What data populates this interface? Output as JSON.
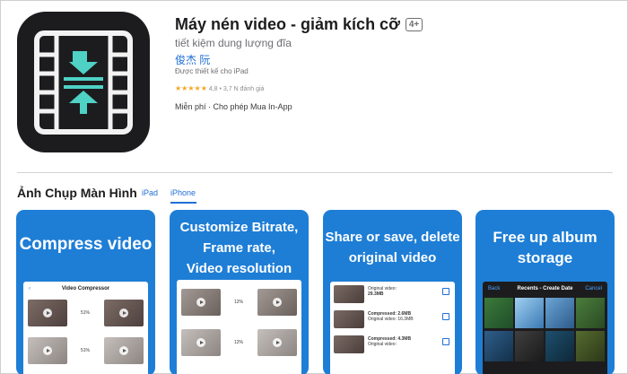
{
  "app": {
    "title": "Máy nén video - giảm kích cỡ",
    "age_rating": "4+",
    "subtitle": "tiết kiệm dung lượng đĩa",
    "developer": "俊杰 阮",
    "designed_for": "Được thiết kế cho iPad",
    "stars": "★★★★★",
    "rating_text": "4,8 • 3,7 N đánh giá",
    "price": "Miễn phí · Cho phép Mua In-App",
    "icon": "video-compress-icon"
  },
  "screenshots_section": {
    "title": "Ảnh Chụp Màn Hình",
    "tabs": [
      {
        "label": "iPad"
      },
      {
        "label": "iPhone"
      }
    ],
    "selected_tab": "iPhone"
  },
  "cards": [
    {
      "caption": "Compress video",
      "screen_title": "Video Compressor",
      "percents": [
        "51%",
        "51%"
      ]
    },
    {
      "caption": "Customize Bitrate,\nFrame rate,\nVideo resolution",
      "percents": [
        "12%",
        "12%"
      ]
    },
    {
      "caption": "Share or save, delete original video",
      "rows": [
        {
          "label": "Original video:",
          "size": "29.3MB"
        },
        {
          "label": "Compressed: 2.6MB",
          "size": "Original video: 16.3MB"
        },
        {
          "label": "Compressed: 4.3MB",
          "size": "Original video:"
        }
      ]
    },
    {
      "caption": "Free up album storage",
      "nav_back": "Back",
      "nav_title": "Recents - Create Date",
      "nav_cancel": "Cancel"
    }
  ],
  "colors": {
    "card_blue": "#1e7ed6",
    "link_blue": "#1f6fd6",
    "star": "#f5a623"
  }
}
